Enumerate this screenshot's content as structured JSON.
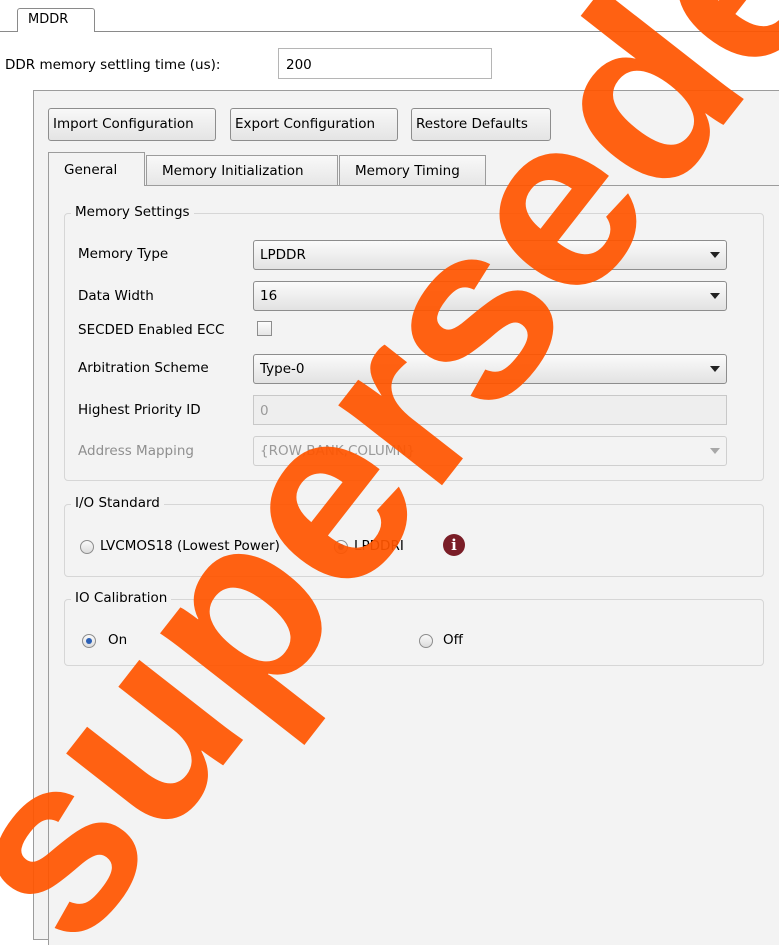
{
  "outer_tab": {
    "label": "MDDR"
  },
  "settling": {
    "label": "DDR memory settling time (us):",
    "value": "200"
  },
  "toolbar": {
    "import_label": "Import Configuration",
    "export_label": "Export Configuration",
    "restore_label": "Restore Defaults"
  },
  "tabs": [
    {
      "label": "General",
      "selected": true
    },
    {
      "label": "Memory Initialization",
      "selected": false
    },
    {
      "label": "Memory Timing",
      "selected": false
    }
  ],
  "memory_settings": {
    "title": "Memory Settings",
    "memory_type": {
      "label": "Memory Type",
      "value": "LPDDR"
    },
    "data_width": {
      "label": "Data Width",
      "value": "16"
    },
    "secded": {
      "label": "SECDED Enabled ECC",
      "checked": false
    },
    "arbitration": {
      "label": "Arbitration Scheme",
      "value": "Type-0"
    },
    "priority_id": {
      "label": "Highest Priority ID",
      "value": "0"
    },
    "address_mapping": {
      "label": "Address Mapping",
      "value": "{ROW,BANK,COLUMN}"
    }
  },
  "io_standard": {
    "title": "I/O Standard",
    "option1": "LVCMOS18 (Lowest Power)",
    "option2": "LPDDRI",
    "selected": "LPDDRI",
    "info_icon": "info-icon"
  },
  "io_calibration": {
    "title": "IO Calibration",
    "on": "On",
    "off": "Off",
    "selected": "On"
  },
  "watermark": {
    "text": "superseded",
    "color": "#ff5500"
  },
  "colors": {
    "radio_selected": "#2a5fb5",
    "info_icon": "#7a1d27"
  }
}
